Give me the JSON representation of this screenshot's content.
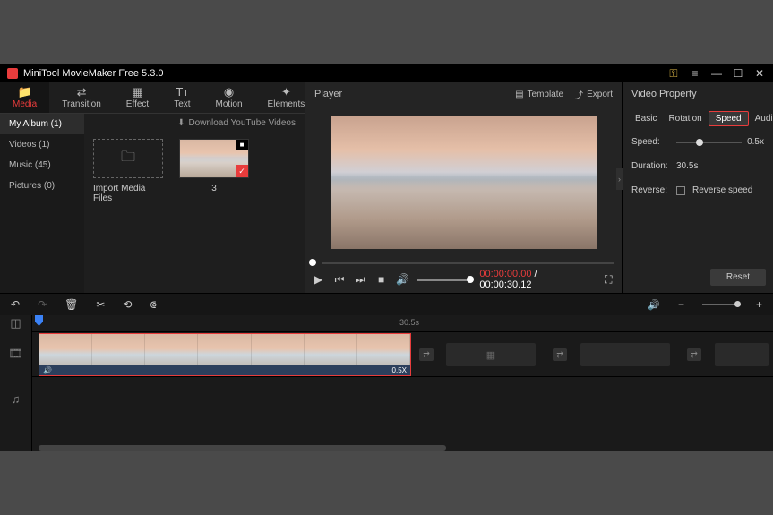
{
  "title_bar": {
    "app_title": "MiniTool MovieMaker Free 5.3.0"
  },
  "tabs": [
    {
      "label": "Media",
      "icon": "📁",
      "active": true
    },
    {
      "label": "Transition",
      "icon": "⇄"
    },
    {
      "label": "Effect",
      "icon": "▦"
    },
    {
      "label": "Text",
      "icon": "Tт"
    },
    {
      "label": "Motion",
      "icon": "◉"
    },
    {
      "label": "Elements",
      "icon": "✦"
    }
  ],
  "categories": [
    {
      "label": "My Album (1)",
      "active": true
    },
    {
      "label": "Videos (1)"
    },
    {
      "label": "Music (45)"
    },
    {
      "label": "Pictures (0)"
    }
  ],
  "download_yt": "Download YouTube Videos",
  "import_label": "Import Media Files",
  "thumb1_label": "3",
  "player": {
    "title": "Player",
    "template": "Template",
    "export": "Export",
    "time_current": "00:00:00.00",
    "time_sep": " / ",
    "time_total": "00:00:30.12"
  },
  "props": {
    "title": "Video Property",
    "tabs": {
      "basic": "Basic",
      "rotation": "Rotation",
      "speed": "Speed",
      "audio": "Audio"
    },
    "speed_label": "Speed:",
    "speed_value": "0.5x",
    "duration_label": "Duration:",
    "duration_value": "30.5s",
    "reverse_label": "Reverse:",
    "reverse_check": "Reverse speed",
    "reset": "Reset"
  },
  "ruler_mark": "30.5s",
  "clip": {
    "speed_badge": "0.5X"
  }
}
